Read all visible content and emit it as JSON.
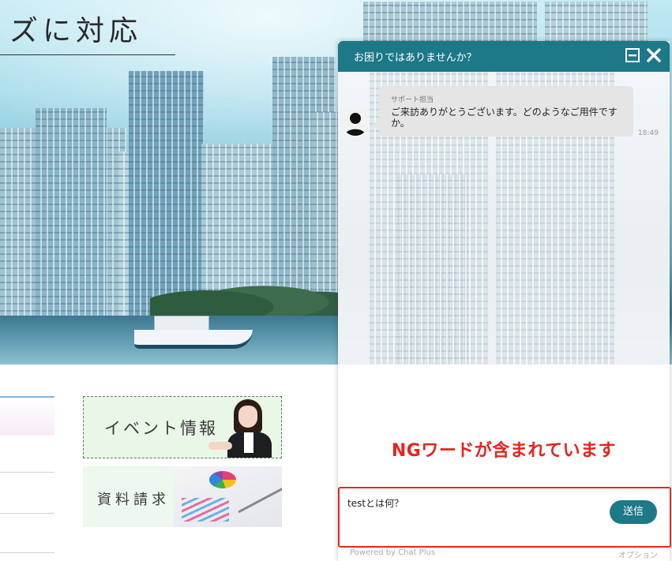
{
  "page": {
    "heading": "ズに対応",
    "banners": {
      "event_label": "イベント情報",
      "document_label": "資料請求"
    }
  },
  "chat": {
    "header_title": "お困りではありませんか？",
    "header_buttons": {
      "minimize_icon": "minimize-icon",
      "close_icon": "close-icon"
    },
    "message": {
      "sender": "サポート担当",
      "text": "ご来訪ありがとうございます。どのようなご用件ですか。",
      "time": "18:49",
      "avatar_icon": "user-avatar-icon"
    },
    "warning": "NGワードが含まれています",
    "input_value": "testとは何？",
    "send_label": "送信",
    "powered_by": "Powered by Chat Plus",
    "option_label": "オプション"
  },
  "colors": {
    "chat_header": "#1d7888",
    "send_button": "#1d7888",
    "warning_text": "#e8221c",
    "input_border": "#e02a1f"
  }
}
